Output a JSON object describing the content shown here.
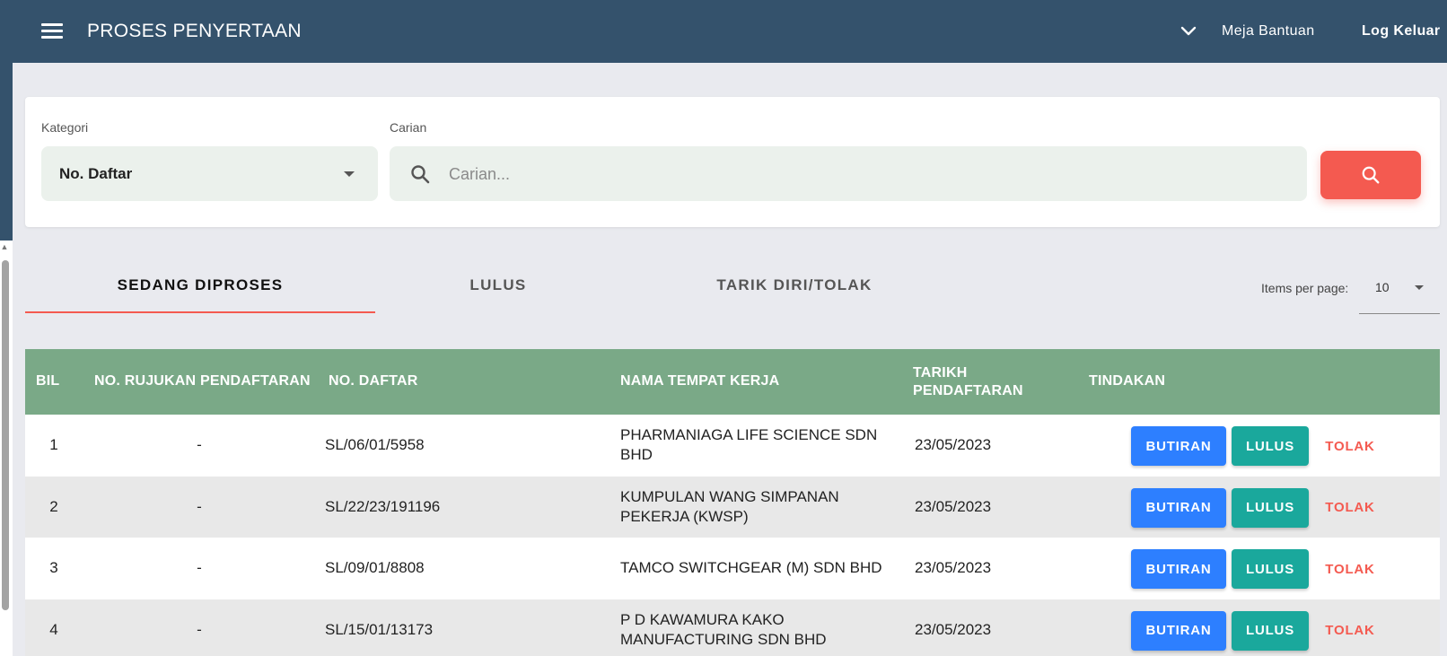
{
  "header": {
    "title": "PROSES PENYERTAAN",
    "help_label": "Meja Bantuan",
    "logout_label": "Log Keluar"
  },
  "filters": {
    "category_label": "Kategori",
    "category_value": "No. Daftar",
    "search_label": "Carian",
    "search_placeholder": "Carian..."
  },
  "tabs": [
    {
      "label": "SEDANG DIPROSES",
      "active": true
    },
    {
      "label": "LULUS",
      "active": false
    },
    {
      "label": "TARIK DIRI/TOLAK",
      "active": false
    }
  ],
  "pagination": {
    "items_per_page_label": "Items per page:",
    "items_per_page_value": "10"
  },
  "table": {
    "headers": [
      "BIL",
      "NO. RUJUKAN PENDAFTARAN",
      "NO. DAFTAR",
      "NAMA TEMPAT KERJA",
      "TARIKH PENDAFTARAN",
      "TINDAKAN"
    ],
    "action_labels": {
      "details": "BUTIRAN",
      "approve": "LULUS",
      "reject": "TOLAK"
    },
    "rows": [
      {
        "bil": "1",
        "rujukan": "-",
        "no_daftar": "SL/06/01/5958",
        "nama": "PHARMANIAGA LIFE SCIENCE SDN BHD",
        "tarikh": "23/05/2023"
      },
      {
        "bil": "2",
        "rujukan": "-",
        "no_daftar": "SL/22/23/191196",
        "nama": "KUMPULAN WANG SIMPANAN PEKERJA (KWSP)",
        "tarikh": "23/05/2023"
      },
      {
        "bil": "3",
        "rujukan": "-",
        "no_daftar": "SL/09/01/8808",
        "nama": "TAMCO SWITCHGEAR (M) SDN BHD",
        "tarikh": "23/05/2023"
      },
      {
        "bil": "4",
        "rujukan": "-",
        "no_daftar": "SL/15/01/13173",
        "nama": "P D KAWAMURA KAKO MANUFACTURING SDN BHD",
        "tarikh": "23/05/2023"
      }
    ]
  },
  "colors": {
    "header_bg": "#34526c",
    "accent": "#f45a50",
    "table_header_bg": "#7aa987",
    "butiran_btn": "#2d7fff",
    "lulus_btn": "#1aa89c"
  }
}
